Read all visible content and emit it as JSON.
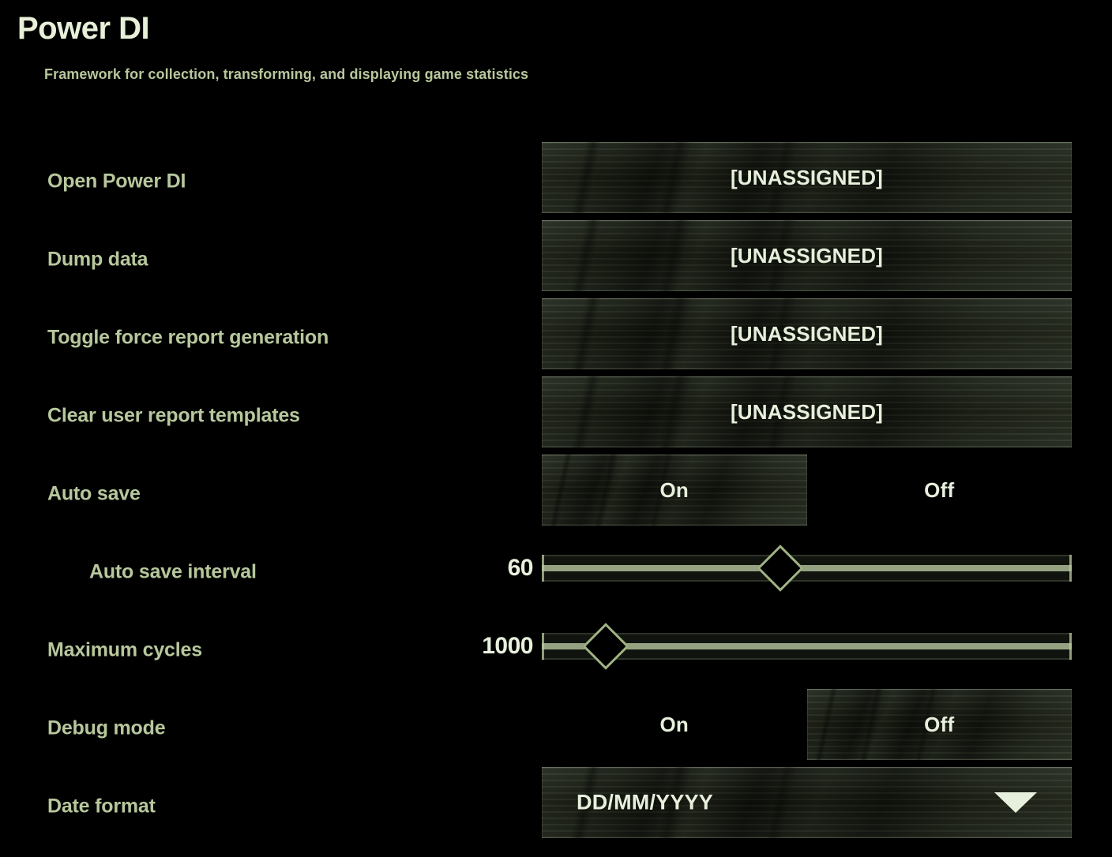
{
  "header": {
    "title": "Power DI",
    "subtitle": "Framework for collection, transforming, and displaying game statistics"
  },
  "colors": {
    "background": "#000000",
    "label_text": "#b7c79c",
    "value_text": "#e7f0dc",
    "title_text": "#e7f0d8",
    "panel_fill": "#1b1f19",
    "panel_border": "#cedcba",
    "slider_line": "#b9caa2",
    "handle_border": "#9fb283"
  },
  "rows": [
    {
      "label": "Open Power DI",
      "type": "keybind",
      "value": "[UNASSIGNED]",
      "indented": false
    },
    {
      "label": "Dump data",
      "type": "keybind",
      "value": "[UNASSIGNED]",
      "indented": false
    },
    {
      "label": "Toggle force report generation",
      "type": "keybind",
      "value": "[UNASSIGNED]",
      "indented": false
    },
    {
      "label": "Clear user report templates",
      "type": "keybind",
      "value": "[UNASSIGNED]",
      "indented": false
    },
    {
      "label": "Auto save",
      "type": "toggle",
      "options": [
        "On",
        "Off"
      ],
      "selected": "On",
      "indented": false
    },
    {
      "label": "Auto save interval",
      "type": "slider",
      "value": "60",
      "fill_percent": 45,
      "indented": true
    },
    {
      "label": "Maximum cycles",
      "type": "slider",
      "value": "1000",
      "fill_percent": 12,
      "indented": false
    },
    {
      "label": "Debug mode",
      "type": "toggle",
      "options": [
        "On",
        "Off"
      ],
      "selected": "Off",
      "indented": false
    },
    {
      "label": "Date format",
      "type": "dropdown",
      "value": "DD/MM/YYYY",
      "arrow_icon": "chevron-down-icon",
      "indented": false
    }
  ]
}
